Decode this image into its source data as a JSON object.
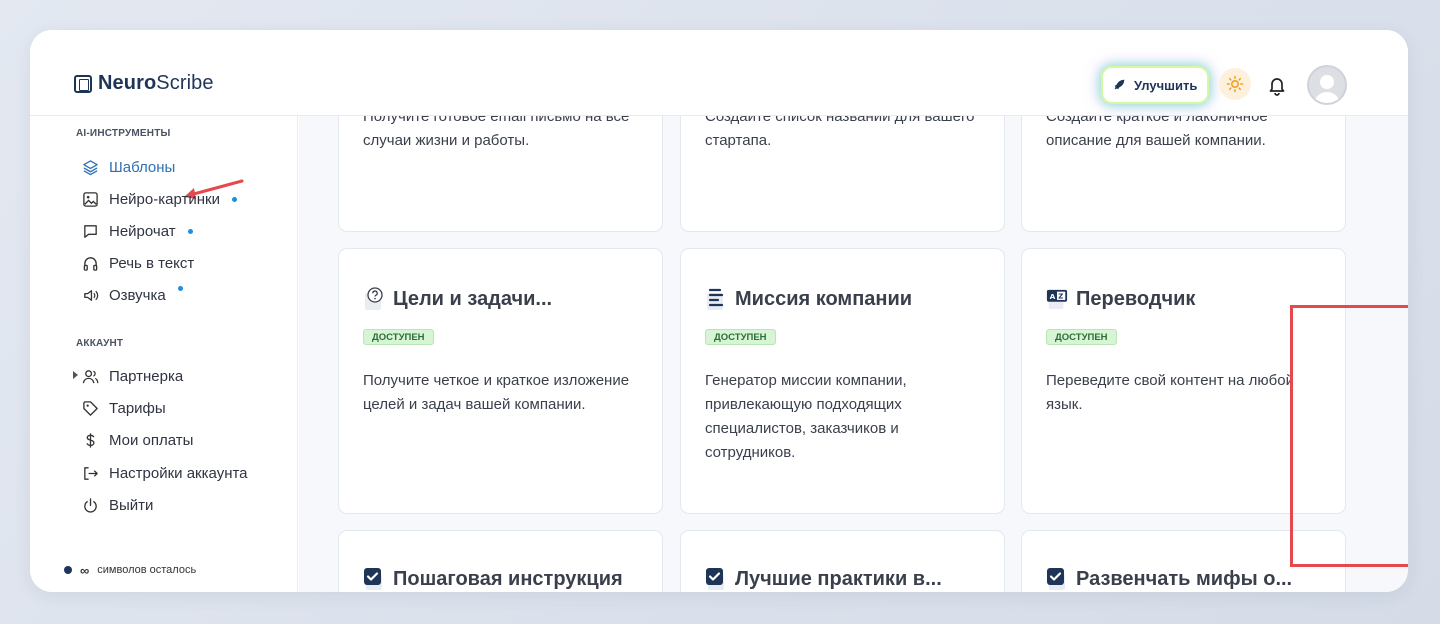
{
  "brand": {
    "name_bold": "Neuro",
    "name_light": "Scribe"
  },
  "header": {
    "upgrade_label": "Улучшить",
    "theme_icon": "sun-icon",
    "bell_icon": "bell-icon",
    "avatar_icon": "user-avatar"
  },
  "sidebar": {
    "section_ai": "AI-ИНСТРУМЕНТЫ",
    "ai_items": [
      {
        "label": "Шаблоны",
        "icon": "layers-icon",
        "active": true
      },
      {
        "label": "Нейро-картинки",
        "icon": "image-icon",
        "dot": true
      },
      {
        "label": "Нейрочат",
        "icon": "chat-icon",
        "dot": true
      },
      {
        "label": "Речь в текст",
        "icon": "headphones-icon"
      },
      {
        "label": "Озвучка",
        "icon": "speaker-icon",
        "dot": true
      }
    ],
    "section_account": "АККАУНТ",
    "account_items": [
      {
        "label": "Партнерка",
        "icon": "users-icon"
      },
      {
        "label": "Тарифы",
        "icon": "tag-icon"
      },
      {
        "label": "Мои оплаты",
        "icon": "dollar-icon"
      },
      {
        "label": "Настройки аккаунта",
        "icon": "logout-arrow-icon"
      },
      {
        "label": "Выйти",
        "icon": "power-icon"
      }
    ],
    "chars_left_prefix": "∞",
    "chars_left_label": "символов осталось"
  },
  "cards": {
    "row1": [
      {
        "desc": "Получите готовое email письмо на все случаи жизни и работы."
      },
      {
        "desc": "Создайте список названий для вашего стартапа."
      },
      {
        "desc": "Создайте краткое и лаконичное описание для вашей компании."
      }
    ],
    "row2": [
      {
        "title": "Цели и задачи...",
        "badge": "ДОСТУПЕН",
        "desc": "Получите четкое и краткое изложение целей и задач вашей компании.",
        "icon": "question-doc-icon"
      },
      {
        "title": "Миссия компании",
        "badge": "ДОСТУПЕН",
        "desc": "Генератор миссии компании, привлекающую подходящих специалистов, заказчиков и сотрудников.",
        "icon": "text-lines-icon"
      },
      {
        "title": "Переводчик",
        "badge": "ДОСТУПЕН",
        "desc": "Переведите свой контент на любой язык.",
        "icon": "translate-icon"
      }
    ],
    "row3": [
      {
        "title": "Пошаговая инструкция",
        "icon": "checkbox-doc-icon"
      },
      {
        "title": "Лучшие практики в...",
        "icon": "checkbox-doc-icon"
      },
      {
        "title": "Развенчать мифы о...",
        "icon": "checkbox-doc-icon"
      }
    ]
  },
  "colors": {
    "brand": "#1f3558",
    "active": "#2f6fb4",
    "badge_bg": "#d7f4d5",
    "highlight": "#e5484d",
    "dot": "#1d8fe0"
  }
}
